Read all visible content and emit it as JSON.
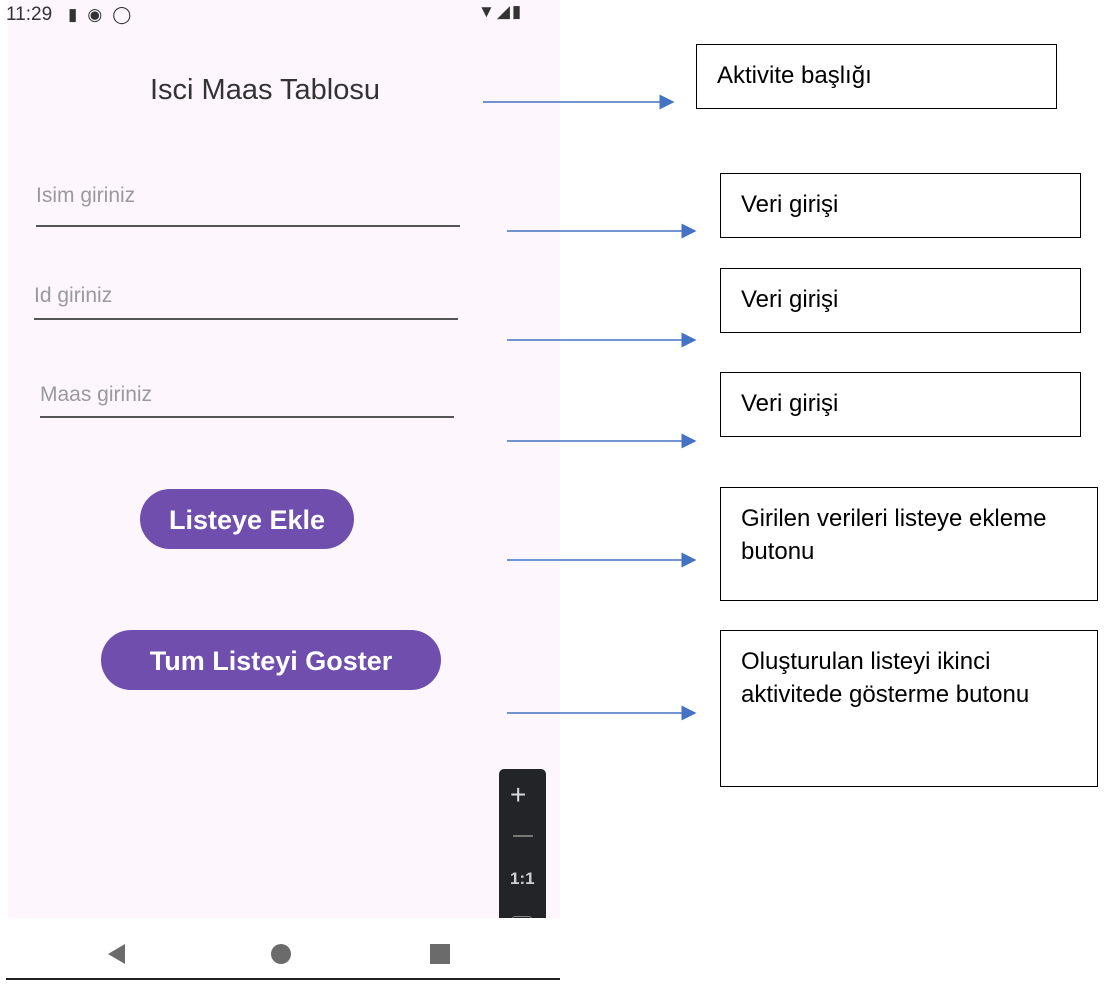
{
  "status_bar": {
    "time": "11:29",
    "left_icons": [
      "sd-card-icon",
      "at-circle-icon",
      "shield-icon"
    ],
    "right_icons": [
      "wifi-icon",
      "signal-icon",
      "battery-icon"
    ]
  },
  "app": {
    "title": "Isci Maas Tablosu",
    "fields": {
      "name_placeholder": "Isim giriniz",
      "id_placeholder": "Id giriniz",
      "salary_placeholder": "Maas giriniz"
    },
    "buttons": {
      "add_label": "Listeye Ekle",
      "show_all_label": "Tum Listeyi Goster"
    },
    "accent_color": "#6f4ead"
  },
  "zoom_controls": {
    "plus": "+",
    "ratio": "1:1"
  },
  "nav_bar": {
    "icons": [
      "back-icon",
      "home-icon",
      "recents-icon"
    ]
  },
  "annotations": {
    "title_note": "Aktivite başlığı",
    "name_note": "Veri girişi",
    "id_note": "Veri girişi",
    "salary_note": "Veri girişi",
    "add_note": "Girilen verileri listeye ekleme butonu",
    "show_note": "Oluşturulan listeyi ikinci aktivitede gösterme butonu",
    "arrow_color": "#4472c4"
  }
}
